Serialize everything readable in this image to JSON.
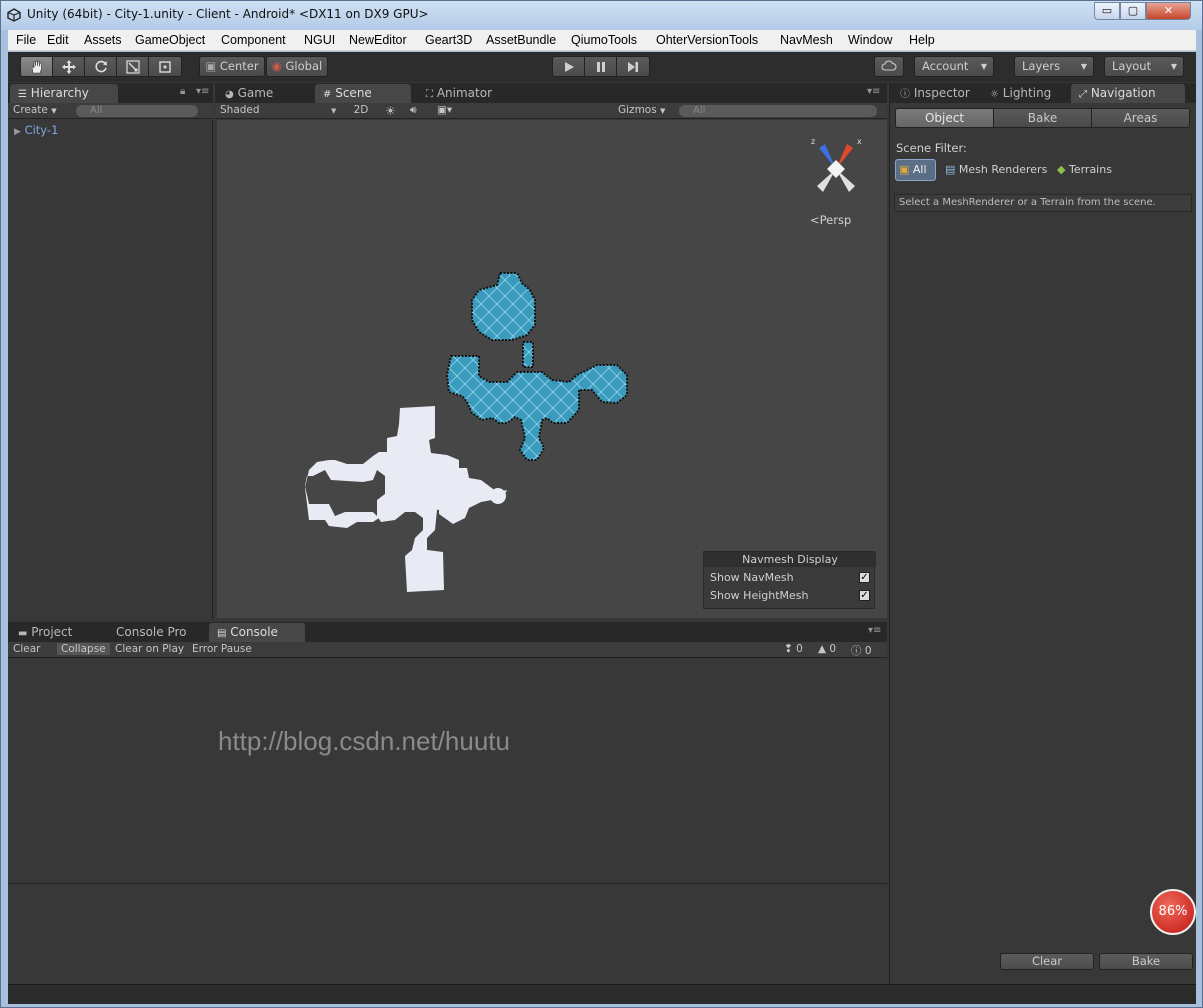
{
  "window": {
    "title": "Unity (64bit) - City-1.unity - Client - Android* <DX11 on DX9 GPU>",
    "min_glyph": "▭",
    "max_glyph": "▢",
    "close_glyph": "✕"
  },
  "menubar": {
    "items": [
      "File",
      "Edit",
      "Assets",
      "GameObject",
      "Component",
      "NGUI",
      "NewEditor",
      "Geart3D",
      "AssetBundle",
      "QiumoTools",
      "OhterVersionTools",
      "NavMesh",
      "Window",
      "Help"
    ]
  },
  "toolbar": {
    "center": "Center",
    "global": "Global",
    "account": "Account",
    "layers": "Layers",
    "layout": "Layout"
  },
  "hierarchy": {
    "tab": "Hierarchy",
    "create": "Create",
    "search_placeholder": "All",
    "items": [
      "City-1"
    ]
  },
  "scene": {
    "tabs": [
      "Game",
      "Scene",
      "Animator"
    ],
    "shaded": "Shaded",
    "mode_2d": "2D",
    "gizmos": "Gizmos",
    "search_placeholder": "All",
    "persp": "Persp",
    "axis_x": "x",
    "axis_z": "z",
    "navmesh_display": {
      "title": "Navmesh Display",
      "show_navmesh": "Show NavMesh",
      "show_heightmesh": "Show HeightMesh",
      "navmesh_checked": true,
      "heightmesh_checked": true
    }
  },
  "inspector": {
    "tabs": [
      "Inspector",
      "Lighting",
      "Navigation"
    ],
    "subtabs": [
      "Object",
      "Bake",
      "Areas"
    ],
    "scene_filter": "Scene Filter:",
    "filters": [
      "All",
      "Mesh Renderers",
      "Terrains"
    ],
    "hint": "Select a MeshRenderer or a Terrain from the scene.",
    "clear": "Clear",
    "bake": "Bake"
  },
  "console": {
    "tabs": [
      "Project",
      "Console Pro",
      "Console"
    ],
    "buttons": [
      "Clear",
      "Collapse",
      "Clear on Play",
      "Error Pause"
    ],
    "info_count": "0",
    "warn_count": "0",
    "error_count": "0",
    "watermark": "http://blog.csdn.net/huutu"
  },
  "overlay": {
    "cpu_percent": "86%"
  },
  "colors": {
    "navmesh": "#3a9bbd",
    "mesh": "#e8ebf3",
    "active_tab": "#474747",
    "editor_bg": "#383838",
    "gizmo_x": "#e34a2b",
    "gizmo_z": "#3b6fe0",
    "badge": "#d9231f"
  }
}
